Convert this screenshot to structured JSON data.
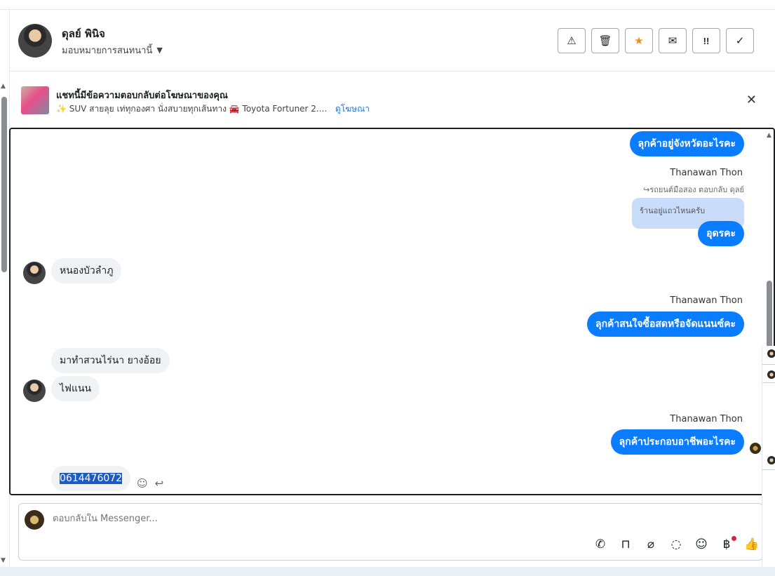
{
  "header": {
    "contact_name": "ดุลย์ พินิจ",
    "assign_label": "มอบหมายการสนทนานี้",
    "toolbar_icons": [
      "warning-icon",
      "trash-icon",
      "star-icon",
      "envelope-open-icon",
      "follow-up-icon",
      "check-icon"
    ],
    "toolbar_glyphs": [
      "⚠",
      "🗑",
      "★",
      "✉",
      "!!",
      "✓"
    ]
  },
  "ad_banner": {
    "title": "แชทนี้มีข้อความตอบกลับต่อโฆษณาของคุณ",
    "description": "✨ SUV สายลุย เท่ทุกองศา นั่งสบายทุกเส้นทาง 🚘 Toyota Fortuner 2....",
    "link_label": "ดูโฆษณา"
  },
  "chat": {
    "messages": [
      {
        "direction": "out",
        "text": "ลุกค้าอยู่จังหวัดอะไรคะ"
      },
      {
        "sender": "Thanawan Thon"
      },
      {
        "reply_note": "↪รถยนต์มือสอง ตอบกลับ ดุลย์"
      },
      {
        "quoted": "ร้านอยู่แถวไหนครับ"
      },
      {
        "direction": "out",
        "text": "อุดรคะ"
      },
      {
        "direction": "in",
        "text": "หนองบัวลำภู"
      },
      {
        "sender": "Thanawan Thon"
      },
      {
        "direction": "out",
        "text": "ลุกค้าสนใจซื้อสดหรือจัดแนนซ์คะ"
      },
      {
        "direction": "in",
        "text": "มาทำสวนไร่นา ยางอ้อย"
      },
      {
        "direction": "in",
        "text": "ไฟแนน"
      },
      {
        "sender": "Thanawan Thon"
      },
      {
        "direction": "out",
        "text": "ลุกค้าประกอบอาชีพอะไรคะ"
      },
      {
        "direction": "in",
        "text": "0614476072",
        "selected": true
      }
    ]
  },
  "composer": {
    "placeholder": "ตอบกลับใน Messenger...",
    "icons": [
      "call-add-icon",
      "shopping-bag-icon",
      "attachment-icon",
      "saved-reply-icon",
      "emoji-icon",
      "baht-icon",
      "like-icon"
    ]
  },
  "colors": {
    "outgoing_bubble": "#0a7cff",
    "incoming_bubble": "#f0f2f5",
    "star": "#f28c28",
    "link": "#1877f2"
  }
}
